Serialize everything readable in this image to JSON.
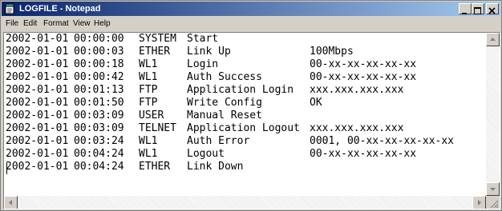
{
  "window": {
    "title": "LOGFILE - Notepad"
  },
  "menu": [
    "File",
    "Edit",
    "Format",
    "View",
    "Help"
  ],
  "log": [
    {
      "date": "2002-01-01",
      "time": "00:00:00",
      "source": "SYSTEM",
      "event": "Start",
      "value": ""
    },
    {
      "date": "2002-01-01",
      "time": "00:00:03",
      "source": "ETHER",
      "event": "Link Up",
      "value": "100Mbps"
    },
    {
      "date": "2002-01-01",
      "time": "00:00:18",
      "source": "WL1",
      "event": "Login",
      "value": "00-xx-xx-xx-xx-xx"
    },
    {
      "date": "2002-01-01",
      "time": "00:00:42",
      "source": "WL1",
      "event": "Auth Success",
      "value": "00-xx-xx-xx-xx-xx"
    },
    {
      "date": "2002-01-01",
      "time": "00:01:13",
      "source": "FTP",
      "event": "Application Login",
      "value": "xxx.xxx.xxx.xxx"
    },
    {
      "date": "2002-01-01",
      "time": "00:01:50",
      "source": "FTP",
      "event": "Write Config",
      "value": "OK"
    },
    {
      "date": "2002-01-01",
      "time": "00:03:09",
      "source": "USER",
      "event": "Manual Reset",
      "value": ""
    },
    {
      "date": "2002-01-01",
      "time": "00:03:09",
      "source": "TELNET",
      "event": "Application Logout",
      "value": "xxx.xxx.xxx.xxx"
    },
    {
      "date": "2002-01-01",
      "time": "00:03:24",
      "source": "WL1",
      "event": "Auth Error",
      "value": "0001, 00-xx-xx-xx-xx-xx"
    },
    {
      "date": "2002-01-01",
      "time": "00:04:24",
      "source": "WL1",
      "event": "Logout",
      "value": "00-xx-xx-xx-xx-xx"
    },
    {
      "date": "2002-01-01",
      "time": "00:04:24",
      "source": "ETHER",
      "event": "Link Down",
      "value": ""
    }
  ],
  "icons": {
    "app": "notepad-icon",
    "minimize": "minimize-icon",
    "maximize": "maximize-icon",
    "close": "close-icon"
  },
  "colors": {
    "titlebar_start": "#0a246a",
    "titlebar_end": "#a6caf0",
    "chrome": "#d4d0c8",
    "editor_bg": "#ffffff"
  }
}
